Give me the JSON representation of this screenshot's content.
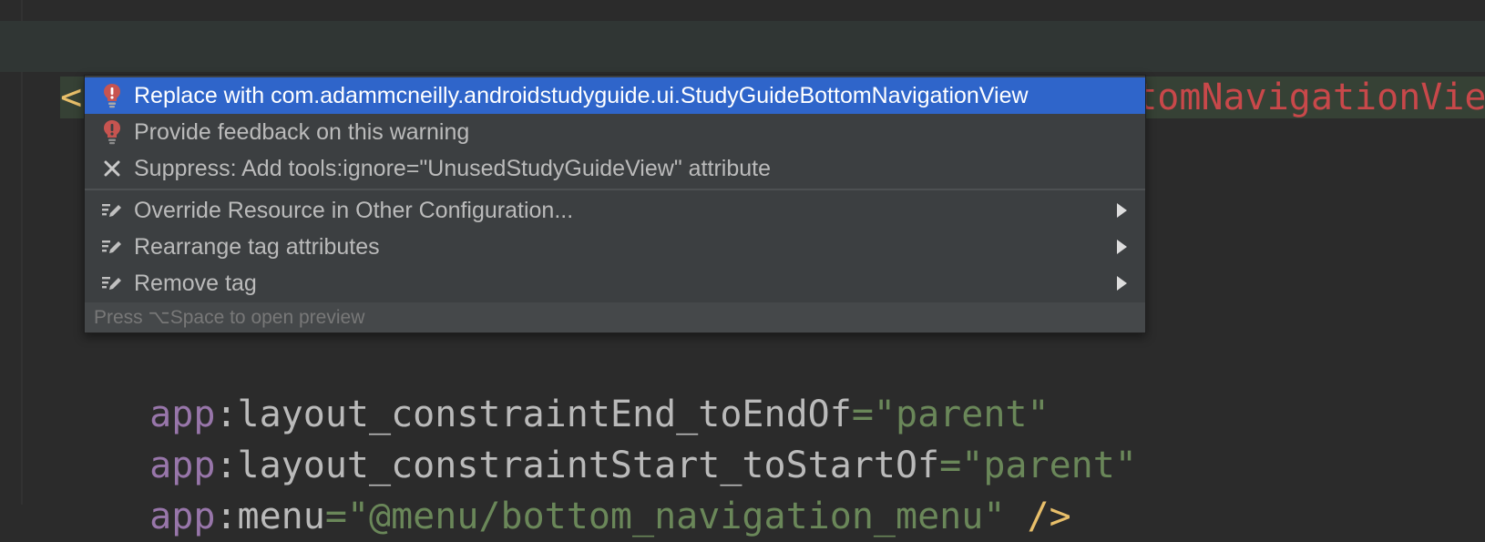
{
  "editor": {
    "line1": {
      "open_bracket": "<",
      "tag": "com.google.android.material.bottomnavigation.BottomNavigationView"
    },
    "line_end": {
      "ns": "app",
      "colon": ":",
      "attr": "layout_constraintEnd_toEndOf",
      "eq": "=",
      "value": "\"parent\""
    },
    "line_start": {
      "ns": "app",
      "colon": ":",
      "attr": "layout_constraintStart_toStartOf",
      "eq": "=",
      "value": "\"parent\""
    },
    "line_menu": {
      "ns": "app",
      "colon": ":",
      "attr": "menu",
      "eq": "=",
      "value": "\"@menu/bottom_navigation_menu\"",
      "close": " />"
    }
  },
  "popup": {
    "items": [
      {
        "label": "Replace with com.adammcneilly.androidstudyguide.ui.StudyGuideBottomNavigationView",
        "icon": "red-bulb-icon",
        "has_submenu": false
      },
      {
        "label": "Provide feedback on this warning",
        "icon": "red-bulb-icon",
        "has_submenu": false
      },
      {
        "label": "Suppress: Add tools:ignore=\"UnusedStudyGuideView\" attribute",
        "icon": "close-x-icon",
        "has_submenu": false
      },
      {
        "label": "Override Resource in Other Configuration...",
        "icon": "edit-intention-icon",
        "has_submenu": true
      },
      {
        "label": "Rearrange tag attributes",
        "icon": "edit-intention-icon",
        "has_submenu": true
      },
      {
        "label": "Remove tag",
        "icon": "edit-intention-icon",
        "has_submenu": true
      }
    ],
    "footer": "Press ⌥Space to open preview"
  },
  "colors": {
    "selection": "#2f65ca",
    "error_bulb": "#c75450",
    "tag_name": "#c8484a",
    "string_value": "#6a8759"
  }
}
